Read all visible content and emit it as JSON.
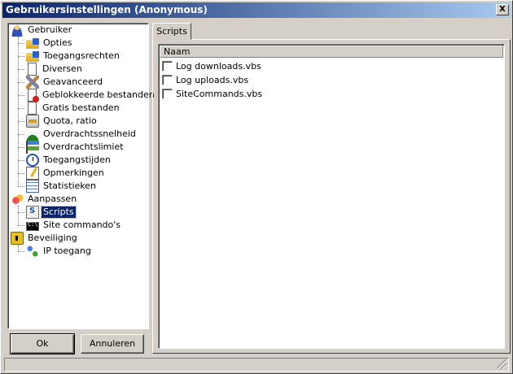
{
  "window": {
    "title": "Gebruikersinstellingen (Anonymous)",
    "close_label": "X"
  },
  "tree": {
    "items": [
      {
        "label": "Gebruiker",
        "icon": "user-icon",
        "level": 0
      },
      {
        "label": "Opties",
        "icon": "options-folder-icon",
        "level": 1
      },
      {
        "label": "Toegangsrechten",
        "icon": "access-rights-folder-icon",
        "level": 1
      },
      {
        "label": "Diversen",
        "icon": "document-icon",
        "level": 1
      },
      {
        "label": "Geavanceerd",
        "icon": "tools-icon",
        "level": 1
      },
      {
        "label": "Geblokkeerde bestanden",
        "icon": "blocked-files-icon",
        "level": 1
      },
      {
        "label": "Gratis bestanden",
        "icon": "free-files-icon",
        "level": 1
      },
      {
        "label": "Quota, ratio",
        "icon": "quota-icon",
        "level": 1
      },
      {
        "label": "Overdrachtssnelheid",
        "icon": "speed-gauge-icon",
        "level": 1
      },
      {
        "label": "Overdrachtslimiet",
        "icon": "transfer-limit-icon",
        "level": 1
      },
      {
        "label": "Toegangstijden",
        "icon": "clock-icon",
        "level": 1
      },
      {
        "label": "Opmerkingen",
        "icon": "notes-icon",
        "level": 1
      },
      {
        "label": "Statistieken",
        "icon": "statistics-icon",
        "level": 1
      },
      {
        "label": "Aanpassen",
        "icon": "customize-icon",
        "level": 0
      },
      {
        "label": "Scripts",
        "icon": "script-icon",
        "level": 1,
        "selected": true
      },
      {
        "label": "Site commando's",
        "icon": "command-prompt-icon",
        "level": 1
      },
      {
        "label": "Beveiliging",
        "icon": "lock-icon",
        "level": 0
      },
      {
        "label": "IP toegang",
        "icon": "network-icon",
        "level": 1
      }
    ]
  },
  "buttons": {
    "ok_label": "Ok",
    "cancel_label": "Annuleren"
  },
  "tabs": [
    {
      "label": "Scripts",
      "active": true
    }
  ],
  "scripts_list": {
    "column_header": "Naam",
    "rows": [
      {
        "label": "Log downloads.vbs",
        "checked": false
      },
      {
        "label": "Log uploads.vbs",
        "checked": false
      },
      {
        "label": "SiteCommands.vbs",
        "checked": false
      }
    ]
  },
  "colors": {
    "title_gradient_start": "#0a246a",
    "title_gradient_end": "#a6caf0",
    "face": "#d4d0c8",
    "selection": "#0a246a"
  }
}
